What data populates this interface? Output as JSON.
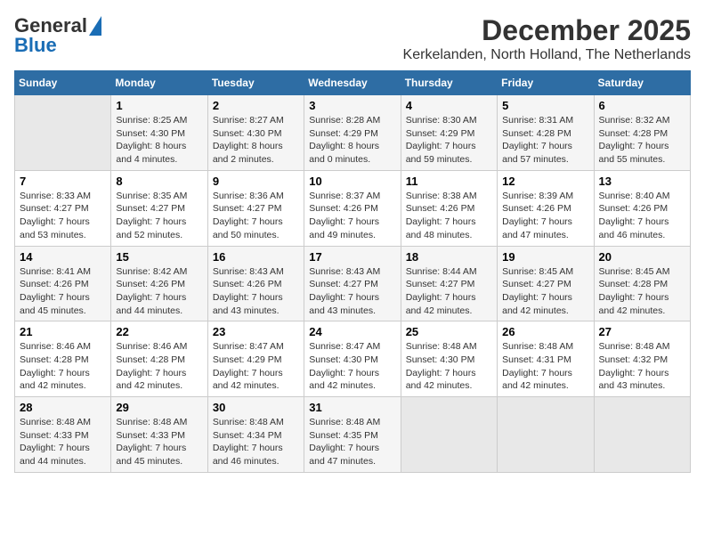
{
  "logo": {
    "line1": "General",
    "line2": "Blue"
  },
  "title": "December 2025",
  "subtitle": "Kerkelanden, North Holland, The Netherlands",
  "days": [
    "Sunday",
    "Monday",
    "Tuesday",
    "Wednesday",
    "Thursday",
    "Friday",
    "Saturday"
  ],
  "weeks": [
    [
      {
        "day": "",
        "content": ""
      },
      {
        "day": "1",
        "content": "Sunrise: 8:25 AM\nSunset: 4:30 PM\nDaylight: 8 hours\nand 4 minutes."
      },
      {
        "day": "2",
        "content": "Sunrise: 8:27 AM\nSunset: 4:30 PM\nDaylight: 8 hours\nand 2 minutes."
      },
      {
        "day": "3",
        "content": "Sunrise: 8:28 AM\nSunset: 4:29 PM\nDaylight: 8 hours\nand 0 minutes."
      },
      {
        "day": "4",
        "content": "Sunrise: 8:30 AM\nSunset: 4:29 PM\nDaylight: 7 hours\nand 59 minutes."
      },
      {
        "day": "5",
        "content": "Sunrise: 8:31 AM\nSunset: 4:28 PM\nDaylight: 7 hours\nand 57 minutes."
      },
      {
        "day": "6",
        "content": "Sunrise: 8:32 AM\nSunset: 4:28 PM\nDaylight: 7 hours\nand 55 minutes."
      }
    ],
    [
      {
        "day": "7",
        "content": "Sunrise: 8:33 AM\nSunset: 4:27 PM\nDaylight: 7 hours\nand 53 minutes."
      },
      {
        "day": "8",
        "content": "Sunrise: 8:35 AM\nSunset: 4:27 PM\nDaylight: 7 hours\nand 52 minutes."
      },
      {
        "day": "9",
        "content": "Sunrise: 8:36 AM\nSunset: 4:27 PM\nDaylight: 7 hours\nand 50 minutes."
      },
      {
        "day": "10",
        "content": "Sunrise: 8:37 AM\nSunset: 4:26 PM\nDaylight: 7 hours\nand 49 minutes."
      },
      {
        "day": "11",
        "content": "Sunrise: 8:38 AM\nSunset: 4:26 PM\nDaylight: 7 hours\nand 48 minutes."
      },
      {
        "day": "12",
        "content": "Sunrise: 8:39 AM\nSunset: 4:26 PM\nDaylight: 7 hours\nand 47 minutes."
      },
      {
        "day": "13",
        "content": "Sunrise: 8:40 AM\nSunset: 4:26 PM\nDaylight: 7 hours\nand 46 minutes."
      }
    ],
    [
      {
        "day": "14",
        "content": "Sunrise: 8:41 AM\nSunset: 4:26 PM\nDaylight: 7 hours\nand 45 minutes."
      },
      {
        "day": "15",
        "content": "Sunrise: 8:42 AM\nSunset: 4:26 PM\nDaylight: 7 hours\nand 44 minutes."
      },
      {
        "day": "16",
        "content": "Sunrise: 8:43 AM\nSunset: 4:26 PM\nDaylight: 7 hours\nand 43 minutes."
      },
      {
        "day": "17",
        "content": "Sunrise: 8:43 AM\nSunset: 4:27 PM\nDaylight: 7 hours\nand 43 minutes."
      },
      {
        "day": "18",
        "content": "Sunrise: 8:44 AM\nSunset: 4:27 PM\nDaylight: 7 hours\nand 42 minutes."
      },
      {
        "day": "19",
        "content": "Sunrise: 8:45 AM\nSunset: 4:27 PM\nDaylight: 7 hours\nand 42 minutes."
      },
      {
        "day": "20",
        "content": "Sunrise: 8:45 AM\nSunset: 4:28 PM\nDaylight: 7 hours\nand 42 minutes."
      }
    ],
    [
      {
        "day": "21",
        "content": "Sunrise: 8:46 AM\nSunset: 4:28 PM\nDaylight: 7 hours\nand 42 minutes."
      },
      {
        "day": "22",
        "content": "Sunrise: 8:46 AM\nSunset: 4:28 PM\nDaylight: 7 hours\nand 42 minutes."
      },
      {
        "day": "23",
        "content": "Sunrise: 8:47 AM\nSunset: 4:29 PM\nDaylight: 7 hours\nand 42 minutes."
      },
      {
        "day": "24",
        "content": "Sunrise: 8:47 AM\nSunset: 4:30 PM\nDaylight: 7 hours\nand 42 minutes."
      },
      {
        "day": "25",
        "content": "Sunrise: 8:48 AM\nSunset: 4:30 PM\nDaylight: 7 hours\nand 42 minutes."
      },
      {
        "day": "26",
        "content": "Sunrise: 8:48 AM\nSunset: 4:31 PM\nDaylight: 7 hours\nand 42 minutes."
      },
      {
        "day": "27",
        "content": "Sunrise: 8:48 AM\nSunset: 4:32 PM\nDaylight: 7 hours\nand 43 minutes."
      }
    ],
    [
      {
        "day": "28",
        "content": "Sunrise: 8:48 AM\nSunset: 4:33 PM\nDaylight: 7 hours\nand 44 minutes."
      },
      {
        "day": "29",
        "content": "Sunrise: 8:48 AM\nSunset: 4:33 PM\nDaylight: 7 hours\nand 45 minutes."
      },
      {
        "day": "30",
        "content": "Sunrise: 8:48 AM\nSunset: 4:34 PM\nDaylight: 7 hours\nand 46 minutes."
      },
      {
        "day": "31",
        "content": "Sunrise: 8:48 AM\nSunset: 4:35 PM\nDaylight: 7 hours\nand 47 minutes."
      },
      {
        "day": "",
        "content": ""
      },
      {
        "day": "",
        "content": ""
      },
      {
        "day": "",
        "content": ""
      }
    ]
  ]
}
